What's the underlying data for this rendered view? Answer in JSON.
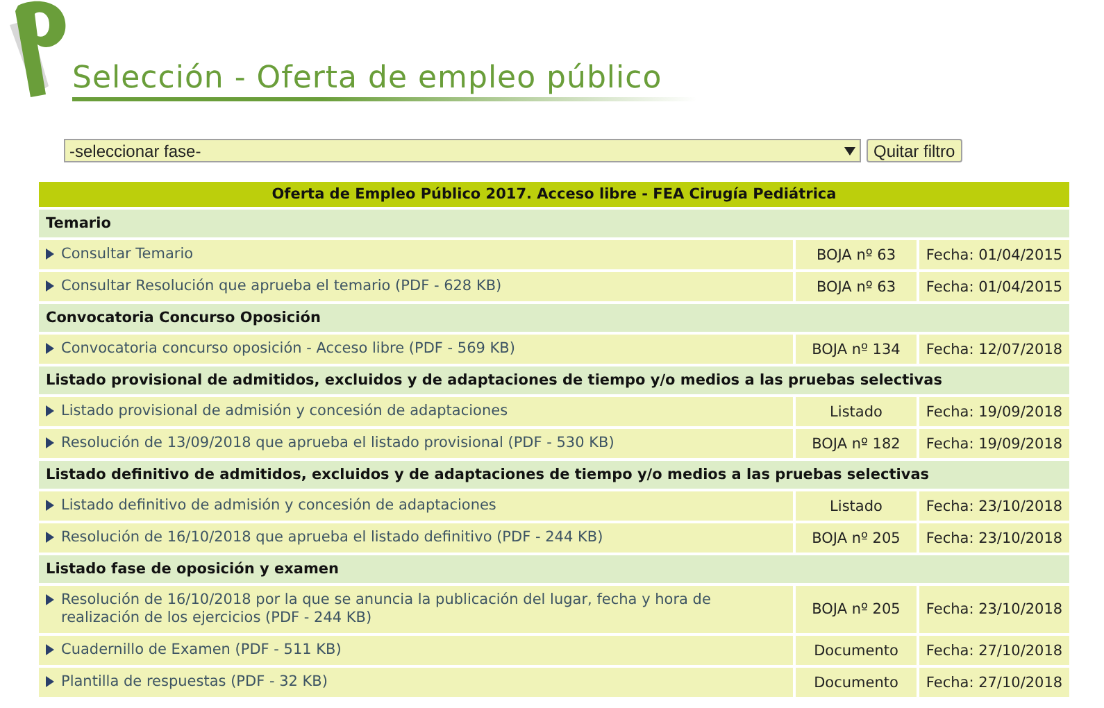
{
  "title": "Selección - Oferta de empleo público",
  "filter": {
    "value": "-seleccionar fase-",
    "button": "Quitar filtro"
  },
  "table": {
    "title": "Oferta de Empleo Público 2017. Acceso libre - FEA Cirugía Pediátrica",
    "sections": [
      {
        "heading": "Temario",
        "rows": [
          {
            "text": "Consultar Temario",
            "source": "BOJA nº 63",
            "date": "Fecha: 01/04/2015"
          },
          {
            "text": "Consultar Resolución que aprueba el temario (PDF - 628 KB)",
            "source": "BOJA nº 63",
            "date": "Fecha: 01/04/2015"
          }
        ]
      },
      {
        "heading": "Convocatoria Concurso Oposición",
        "rows": [
          {
            "text": "Convocatoria concurso oposición - Acceso libre (PDF - 569 KB)",
            "source": "BOJA nº 134",
            "date": "Fecha: 12/07/2018"
          }
        ]
      },
      {
        "heading": "Listado provisional de admitidos, excluidos y de adaptaciones de tiempo y/o medios a las pruebas selectivas",
        "rows": [
          {
            "text": "Listado provisional de admisión y concesión de adaptaciones",
            "source": "Listado",
            "date": "Fecha: 19/09/2018"
          },
          {
            "text": "Resolución de 13/09/2018 que aprueba el listado provisional (PDF - 530 KB)",
            "source": "BOJA nº 182",
            "date": "Fecha: 19/09/2018"
          }
        ]
      },
      {
        "heading": "Listado definitivo de admitidos, excluidos y de adaptaciones de tiempo y/o medios a las pruebas selectivas",
        "rows": [
          {
            "text": "Listado definitivo de admisión y concesión de adaptaciones",
            "source": "Listado",
            "date": "Fecha: 23/10/2018"
          },
          {
            "text": "Resolución de 16/10/2018 que aprueba el listado definitivo (PDF - 244 KB)",
            "source": "BOJA nº 205",
            "date": "Fecha: 23/10/2018"
          }
        ]
      },
      {
        "heading": "Listado fase de oposición y examen",
        "rows": [
          {
            "text": "Resolución de 16/10/2018 por la que se anuncia la publicación del lugar, fecha y hora de realización de los ejercicios (PDF - 244 KB)",
            "source": "BOJA nº 205",
            "date": "Fecha: 23/10/2018"
          },
          {
            "text": "Cuadernillo de Examen (PDF - 511 KB)",
            "source": "Documento",
            "date": "Fecha: 27/10/2018"
          },
          {
            "text": "Plantilla de respuestas (PDF - 32 KB)",
            "source": "Documento",
            "date": "Fecha: 27/10/2018"
          }
        ]
      }
    ]
  }
}
